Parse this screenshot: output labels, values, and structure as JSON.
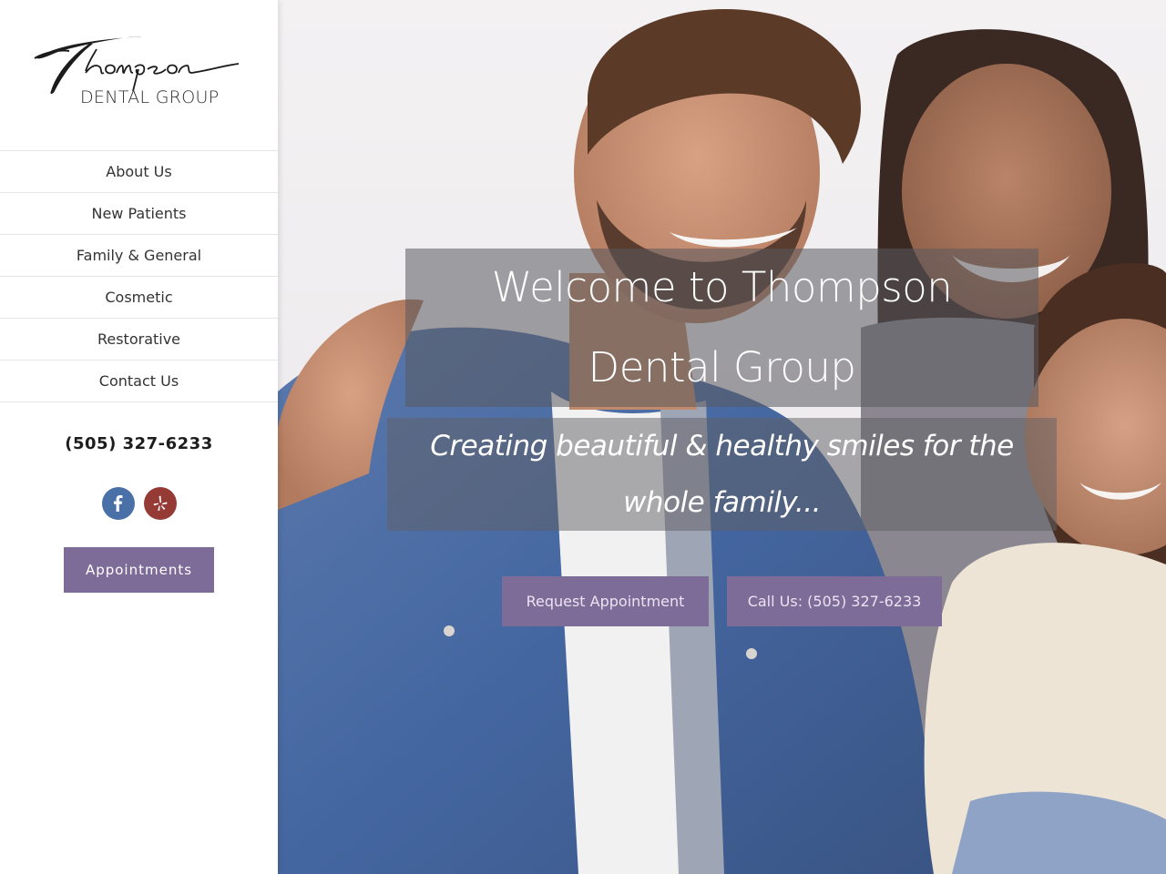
{
  "brand": {
    "logo_script": "Thompson",
    "logo_subtitle": "DENTAL GROUP"
  },
  "sidebar": {
    "nav_items": [
      {
        "label": "About Us"
      },
      {
        "label": "New Patients"
      },
      {
        "label": "Family & General"
      },
      {
        "label": "Cosmetic"
      },
      {
        "label": "Restorative"
      },
      {
        "label": "Contact Us"
      }
    ],
    "phone": "(505) 327-6233",
    "social": [
      {
        "name": "facebook",
        "icon": "facebook-icon",
        "color": "#4a70a8"
      },
      {
        "name": "yelp",
        "icon": "yelp-icon",
        "color": "#963a36"
      }
    ],
    "appointments_label": "Appointments"
  },
  "hero": {
    "title": "Welcome to Thompson Dental Group",
    "tagline": "Creating beautiful & healthy smiles for the whole family...",
    "request_button": "Request Appointment",
    "call_button": "Call Us: (505) 327-6233"
  },
  "colors": {
    "accent": "#7d6b98",
    "overlay": "#5a5a5f"
  }
}
